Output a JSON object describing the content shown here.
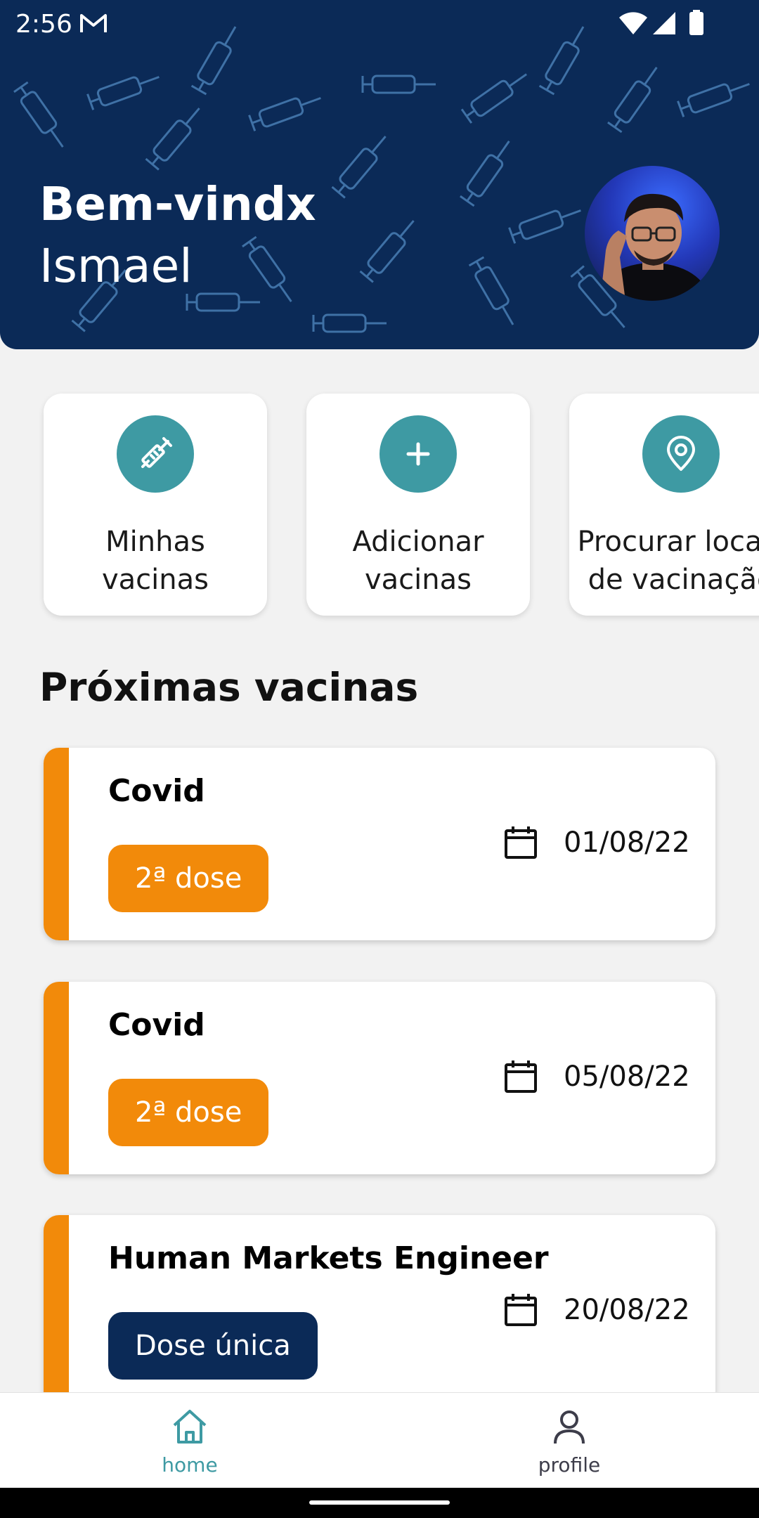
{
  "status_bar": {
    "time": "2:56"
  },
  "header": {
    "greeting": "Bem-vindx",
    "username": "Ismael"
  },
  "quick_actions": [
    {
      "label": "Minhas\nvacinas",
      "icon": "syringe-icon"
    },
    {
      "label": "Adicionar\nvacinas",
      "icon": "plus-icon"
    },
    {
      "label": "Procurar locais\nde vacinação",
      "icon": "location-pin-icon"
    }
  ],
  "section": {
    "title": "Próximas vacinas"
  },
  "vaccines": [
    {
      "name": "Covid",
      "dose": "2ª dose",
      "date": "01/08/22",
      "dose_color": "#f28a0a"
    },
    {
      "name": "Covid",
      "dose": "2ª dose",
      "date": "05/08/22",
      "dose_color": "#f28a0a"
    },
    {
      "name": "Human Markets Engineer",
      "dose": "Dose única",
      "date": "20/08/22",
      "dose_color": "#0b2a57"
    }
  ],
  "nav": [
    {
      "label": "home",
      "icon": "home-icon",
      "active": true
    },
    {
      "label": "profile",
      "icon": "person-icon",
      "active": false
    }
  ],
  "colors": {
    "header_bg": "#0b2a57",
    "accent_teal": "#3e9aa3",
    "accent_orange": "#f28a0a",
    "page_bg": "#f2f2f2"
  }
}
